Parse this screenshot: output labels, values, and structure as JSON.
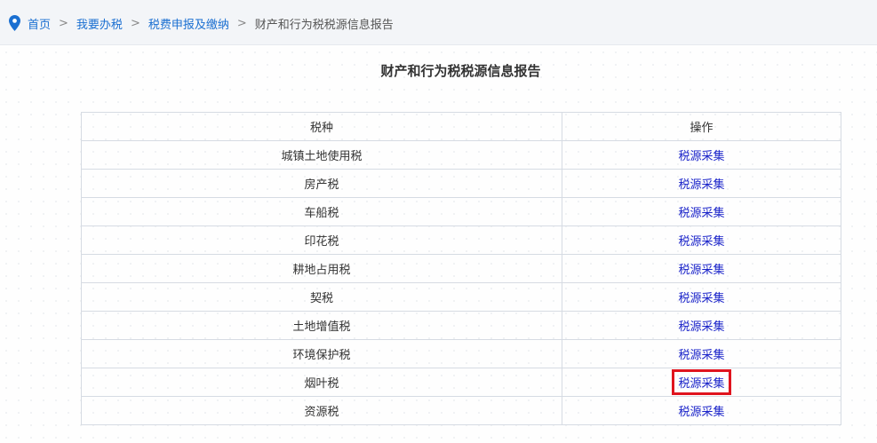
{
  "breadcrumb": {
    "items": [
      "首页",
      "我要办税",
      "税费申报及缴纳"
    ],
    "current": "财产和行为税税源信息报告",
    "separator": ">"
  },
  "page_title": "财产和行为税税源信息报告",
  "table": {
    "headers": [
      "税种",
      "操作"
    ],
    "rows": [
      {
        "tax": "城镇土地使用税",
        "action": "税源采集"
      },
      {
        "tax": "房产税",
        "action": "税源采集"
      },
      {
        "tax": "车船税",
        "action": "税源采集"
      },
      {
        "tax": "印花税",
        "action": "税源采集"
      },
      {
        "tax": "耕地占用税",
        "action": "税源采集"
      },
      {
        "tax": "契税",
        "action": "税源采集"
      },
      {
        "tax": "土地增值税",
        "action": "税源采集"
      },
      {
        "tax": "环境保护税",
        "action": "税源采集"
      },
      {
        "tax": "烟叶税",
        "action": "税源采集",
        "highlighted": true
      },
      {
        "tax": "资源税",
        "action": "税源采集"
      }
    ]
  },
  "colors": {
    "link": "#1a6fd1",
    "action_link": "#1a23c9",
    "highlight": "#e0141e",
    "pin": "#1a6fd1"
  },
  "icons": {
    "location": "location-pin-icon"
  }
}
